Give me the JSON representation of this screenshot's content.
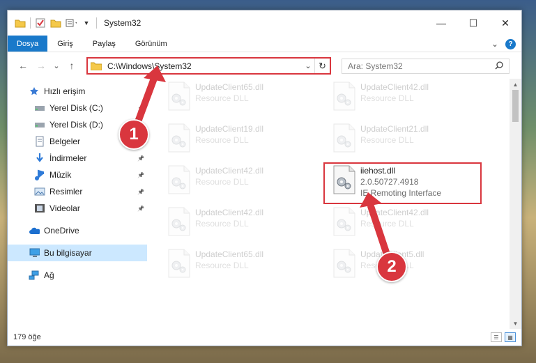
{
  "window": {
    "title": "System32",
    "controls": {
      "minimize": "—",
      "maximize": "☐",
      "close": "✕"
    }
  },
  "ribbon": {
    "tabs": [
      "Dosya",
      "Giriş",
      "Paylaş",
      "Görünüm"
    ],
    "collapse_glyph": "⌄",
    "help_glyph": "?"
  },
  "address": {
    "path": "C:\\Windows\\System32",
    "dropdown_glyph": "⌄",
    "refresh_glyph": "↻"
  },
  "search": {
    "placeholder": "Ara: System32",
    "icon": "search-icon"
  },
  "nav": {
    "back": "←",
    "forward": "→",
    "recent": "⌄",
    "up": "↑",
    "items": [
      {
        "label": "Hızlı erişim",
        "icon": "star-icon",
        "level": "top",
        "pinned": false
      },
      {
        "label": "Yerel Disk (C:)",
        "icon": "drive-icon",
        "level": "sub",
        "pinned": true
      },
      {
        "label": "Yerel Disk (D:)",
        "icon": "drive-icon",
        "level": "sub",
        "pinned": true
      },
      {
        "label": "Belgeler",
        "icon": "documents-icon",
        "level": "sub",
        "pinned": true
      },
      {
        "label": "İndirmeler",
        "icon": "download-icon",
        "level": "sub",
        "pinned": true
      },
      {
        "label": "Müzik",
        "icon": "music-icon",
        "level": "sub",
        "pinned": true
      },
      {
        "label": "Resimler",
        "icon": "pictures-icon",
        "level": "sub",
        "pinned": true
      },
      {
        "label": "Videolar",
        "icon": "videos-icon",
        "level": "sub",
        "pinned": true
      },
      {
        "label": "OneDrive",
        "icon": "cloud-icon",
        "level": "top",
        "pinned": false
      },
      {
        "label": "Bu bilgisayar",
        "icon": "computer-icon",
        "level": "top",
        "pinned": false
      },
      {
        "label": "Ağ",
        "icon": "network-icon",
        "level": "top",
        "pinned": false
      }
    ]
  },
  "files": [
    {
      "name": "UpdateClient65.dll",
      "type": "Resource DLL",
      "faded": true
    },
    {
      "name": "UpdateClient42.dll",
      "type": "Resource DLL",
      "faded": true
    },
    {
      "name": "UpdateClient19.dll",
      "type": "Resource DLL",
      "faded": true
    },
    {
      "name": "UpdateClient21.dll",
      "type": "Resource DLL",
      "faded": true
    },
    {
      "name": "UpdateClient42.dll",
      "type": "Resource DLL",
      "faded": true
    },
    {
      "name": "iiehost.dll",
      "version": "2.0.50727.4918",
      "type": "IE Remoting Interface",
      "faded": false
    },
    {
      "name": "UpdateClient42.dll",
      "type": "Resource DLL",
      "faded": true
    },
    {
      "name": "UpdateClient42.dll",
      "type": "Resource DLL",
      "faded": true
    },
    {
      "name": "UpdateClient65.dll",
      "type": "Resource DLL",
      "faded": true
    },
    {
      "name": "UpdateClient5.dll",
      "type": "Resource DLL",
      "faded": true
    }
  ],
  "status": {
    "count": "179 öğe"
  },
  "annotations": {
    "step1": "1",
    "step2": "2",
    "color": "#d9363e"
  }
}
